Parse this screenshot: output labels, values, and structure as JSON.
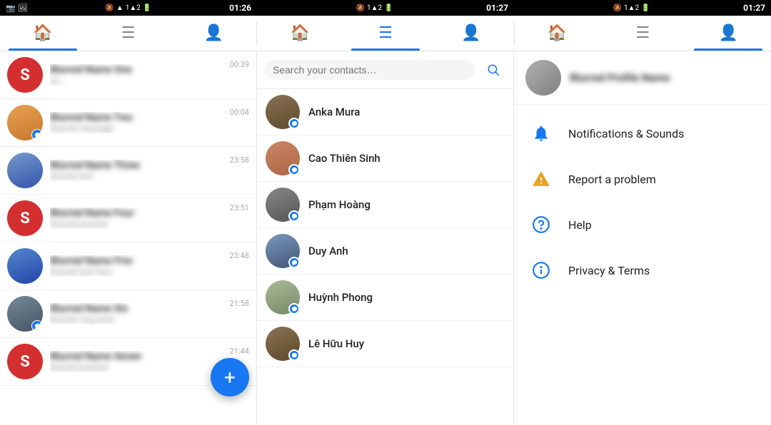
{
  "statusBars": [
    {
      "leftIcons": "📷 🖼",
      "rightIcons": "📵 📶 1▲2▼ 🔋",
      "time": "01:26"
    },
    {
      "leftIcons": "📵 📶 1▲2▼ 🔋",
      "rightIcons": "",
      "time": "01:27"
    },
    {
      "leftIcons": "",
      "rightIcons": "📵 📶 1▲2▼ 🔋",
      "time": "01:27"
    }
  ],
  "tabs": {
    "left": [
      {
        "id": "home-left",
        "icon": "🏠",
        "active": true
      },
      {
        "id": "menu-left",
        "icon": "☰",
        "active": false
      },
      {
        "id": "profile-left",
        "icon": "👤",
        "active": false
      }
    ],
    "mid": [
      {
        "id": "home-mid",
        "icon": "🏠",
        "active": false
      },
      {
        "id": "menu-mid",
        "icon": "☰",
        "active": true
      },
      {
        "id": "profile-mid",
        "icon": "👤",
        "active": false
      }
    ],
    "right": [
      {
        "id": "home-right",
        "icon": "🏠",
        "active": false
      },
      {
        "id": "menu-right",
        "icon": "☰",
        "active": false
      },
      {
        "id": "profile-right",
        "icon": "👤",
        "active": true
      }
    ]
  },
  "conversations": [
    {
      "name": "Blurred Name 1",
      "preview": "blurred preview text here na...",
      "time": "00:39",
      "avatarType": "red-s",
      "hasBadge": false
    },
    {
      "name": "Blurred Name 2",
      "preview": "blurred message preview",
      "time": "00:04",
      "avatarType": "cat-face",
      "hasBadge": true
    },
    {
      "name": "Blurred Name 3",
      "preview": "blurred message text here",
      "time": "23:58",
      "avatarType": "person-1",
      "hasBadge": false
    },
    {
      "name": "Blurred Name 4",
      "preview": "blurred short",
      "time": "23:51",
      "avatarType": "red-s2",
      "hasBadge": false
    },
    {
      "name": "Blurred Name 5",
      "preview": "blurred preview",
      "time": "23:48",
      "avatarType": "person-2",
      "hasBadge": false
    },
    {
      "name": "Blurred Name 6",
      "preview": "blurred text here",
      "time": "21:58",
      "avatarType": "person-3",
      "hasBadge": true
    },
    {
      "name": "Blurred Name 7",
      "preview": "blurred text",
      "time": "21:44",
      "avatarType": "red-s3",
      "hasBadge": false
    }
  ],
  "fab": {
    "label": "+"
  },
  "search": {
    "placeholder": "Search your contacts…"
  },
  "contacts": [
    {
      "name": "Anka Mura",
      "avatarClass": "ca-1",
      "hasBadge": true
    },
    {
      "name": "Cao Thiên Sinh",
      "avatarClass": "ca-2",
      "hasBadge": true
    },
    {
      "name": "Phạm Hoàng",
      "avatarClass": "ca-3",
      "hasBadge": true
    },
    {
      "name": "Duy Anh",
      "avatarClass": "ca-4",
      "hasBadge": true
    },
    {
      "name": "Huỳnh Phong",
      "avatarClass": "ca-5",
      "hasBadge": true
    },
    {
      "name": "Lê Hữu Huy",
      "avatarClass": "ca-1",
      "hasBadge": true
    }
  ],
  "menu": {
    "profileName": "Blurred Profile Name",
    "items": [
      {
        "id": "notifications",
        "iconType": "bell",
        "label": "Notifications & Sounds"
      },
      {
        "id": "report",
        "iconType": "triangle",
        "label": "Report a problem"
      },
      {
        "id": "help",
        "iconType": "question",
        "label": "Help"
      },
      {
        "id": "privacy",
        "iconType": "info",
        "label": "Privacy & Terms"
      }
    ]
  }
}
